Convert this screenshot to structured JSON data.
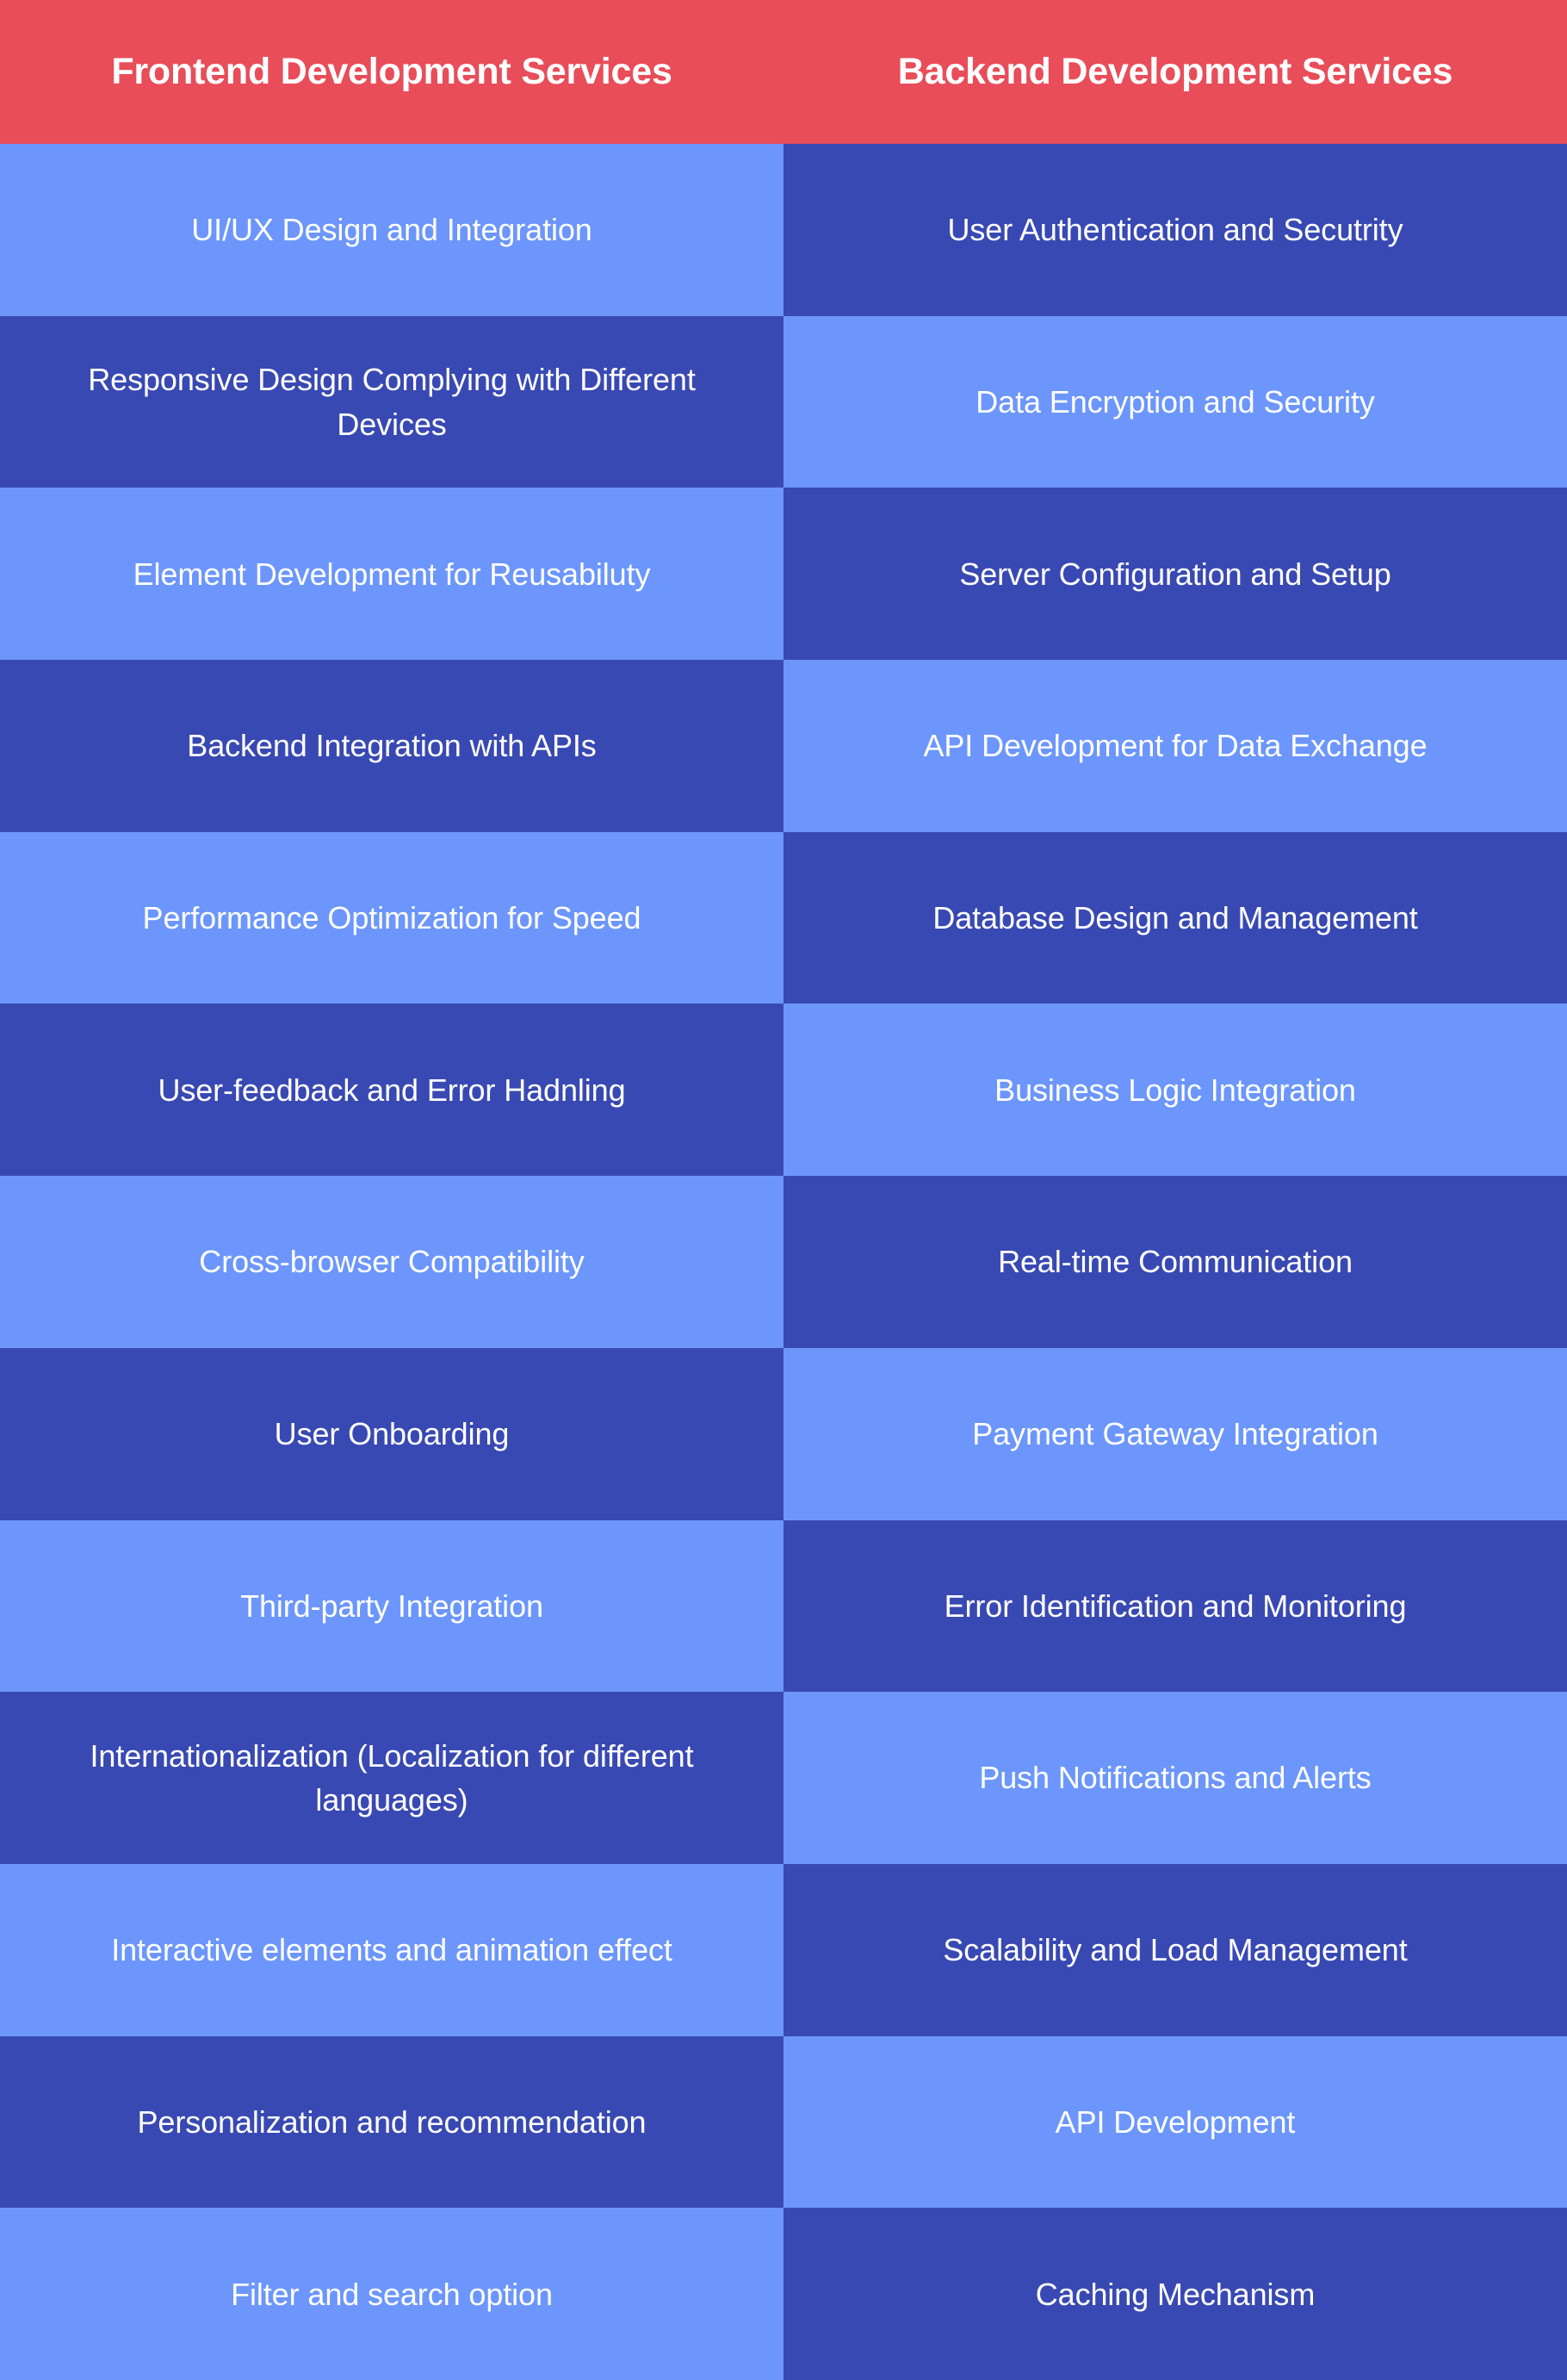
{
  "colors": {
    "header_background": "#e84d59",
    "cell_light": "#6c96fc",
    "cell_dark": "#3949b3",
    "text": "#ffffff"
  },
  "header": {
    "left_title": "Frontend Development Services",
    "right_title": "Backend Development Services"
  },
  "table": {
    "columns": [
      "Frontend Development Services",
      "Backend Development Services"
    ],
    "rows": [
      {
        "frontend": "UI/UX Design and Integration",
        "backend": "User Authentication and Secutrity"
      },
      {
        "frontend": "Responsive Design Complying with Different Devices",
        "backend": "Data Encryption and Security"
      },
      {
        "frontend": "Element Development for Reusabiluty",
        "backend": "Server Configuration and Setup"
      },
      {
        "frontend": "Backend Integration with APIs",
        "backend": "API Development for Data Exchange"
      },
      {
        "frontend": "Performance Optimization for Speed",
        "backend": "Database Design and Management"
      },
      {
        "frontend": "User-feedback and Error Hadnling",
        "backend": "Business Logic Integration"
      },
      {
        "frontend": "Cross-browser Compatibility",
        "backend": "Real-time Communication"
      },
      {
        "frontend": "User Onboarding",
        "backend": "Payment Gateway Integration"
      },
      {
        "frontend": "Third-party Integration",
        "backend": "Error Identification and Monitoring"
      },
      {
        "frontend": "Internationalization (Localization for different languages)",
        "backend": "Push Notifications and Alerts"
      },
      {
        "frontend": "Interactive elements and animation effect",
        "backend": "Scalability and Load Management"
      },
      {
        "frontend": "Personalization and recommendation",
        "backend": "API Development"
      },
      {
        "frontend": "Filter and search option",
        "backend": "Caching Mechanism"
      }
    ]
  }
}
